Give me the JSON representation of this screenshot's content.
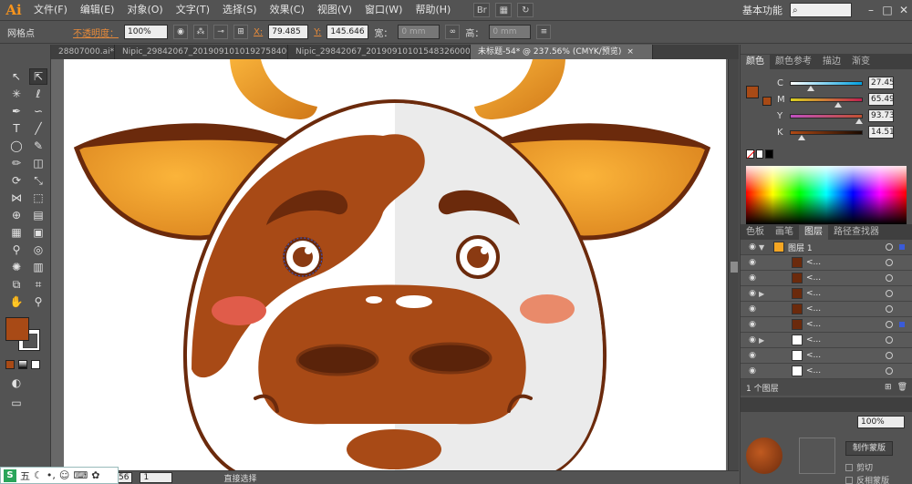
{
  "app": {
    "logo": "Ai",
    "workspace": "基本功能"
  },
  "menu": [
    "文件(F)",
    "编辑(E)",
    "对象(O)",
    "文字(T)",
    "选择(S)",
    "效果(C)",
    "视图(V)",
    "窗口(W)",
    "帮助(H)"
  ],
  "control": {
    "selection_label": "网格点",
    "opacity_label": "不透明度：",
    "opacity_value": "100%",
    "x_label": "X:",
    "x_value": "79.485",
    "y_label": "Y:",
    "y_value": "145.646",
    "w_label": "宽：",
    "w_value": "0 mm",
    "h_label": "高：",
    "h_value": "0 mm"
  },
  "tabs": [
    {
      "label": "28807000.ai*",
      "active": false
    },
    {
      "label": "Nipic_29842067_20190910101927584000.ai*",
      "active": false
    },
    {
      "label": "Nipic_29842067_20190910101548326000.ai*",
      "active": false
    },
    {
      "label": "未标题-54* @ 237.56% (CMYK/预览)",
      "active": true
    }
  ],
  "color_panel": {
    "tabs": [
      "颜色",
      "颜色参考",
      "描边",
      "渐变"
    ],
    "channels": [
      {
        "name": "C",
        "value": "27.45",
        "pos": 0.27,
        "from": "#ffffff",
        "to": "#00a0e0"
      },
      {
        "name": "M",
        "value": "65.49",
        "pos": 0.65,
        "from": "#d8d020",
        "to": "#c02050"
      },
      {
        "name": "Y",
        "value": "93.73",
        "pos": 0.94,
        "from": "#c050c0",
        "to": "#c05030"
      },
      {
        "name": "K",
        "value": "14.51",
        "pos": 0.15,
        "from": "#b04a15",
        "to": "#1a0a00"
      }
    ],
    "fill_color": "#a84a16"
  },
  "layers_panel": {
    "tabs": [
      "色板",
      "画笔",
      "图层",
      "路径查找器"
    ],
    "rows": [
      {
        "name": "图层 1",
        "top": true
      },
      {
        "name": "<...",
        "top": false
      },
      {
        "name": "<...",
        "top": false
      },
      {
        "name": "<...",
        "top": false
      },
      {
        "name": "<...",
        "top": false
      },
      {
        "name": "<...",
        "top": false
      },
      {
        "name": "<...",
        "top": false
      },
      {
        "name": "<...",
        "top": false
      },
      {
        "name": "<...",
        "top": false
      }
    ],
    "footer": "1 个图层"
  },
  "transparency": {
    "opacity_value": "100%",
    "mask_button": "制作蒙版",
    "clip_label": "剪切",
    "invert_label": "反相蒙版"
  },
  "status": {
    "zoom": "56",
    "page": "1",
    "tool": "直接选择"
  },
  "ime": {
    "mode": "五"
  },
  "colors": {
    "cow_brown": "#a84a16",
    "cow_dark": "#6b2a0c",
    "horn": "#f5a623",
    "cheek": "#e05c4a"
  }
}
